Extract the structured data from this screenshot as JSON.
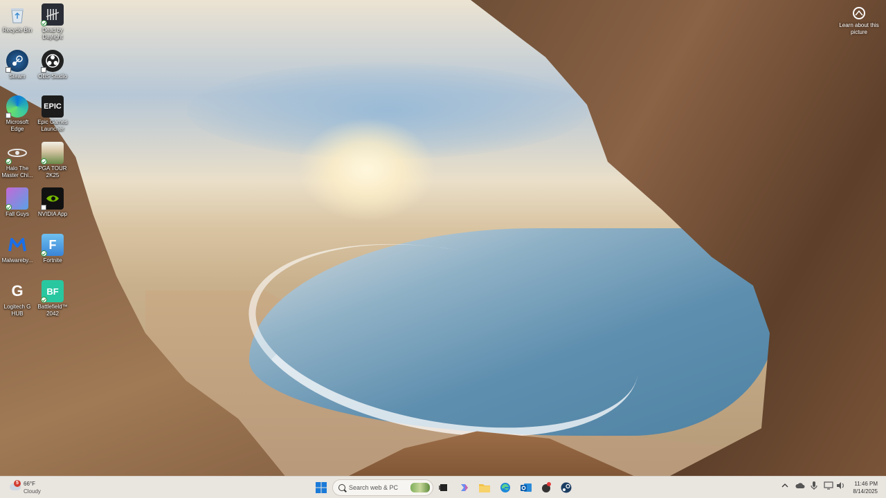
{
  "desktop": {
    "icons": [
      {
        "label": "Recycle Bin",
        "icon": "recycle-bin-icon"
      },
      {
        "label": "Dead by Daylight",
        "icon": "dead-by-daylight-icon"
      },
      {
        "label": "Steam",
        "icon": "steam-icon"
      },
      {
        "label": "OBS Studio",
        "icon": "obs-studio-icon"
      },
      {
        "label": "Microsoft Edge",
        "icon": "edge-icon"
      },
      {
        "label": "Epic Games Launcher",
        "icon": "epic-games-icon",
        "glyph": "EPIC"
      },
      {
        "label": "Halo The Master Chi...",
        "icon": "halo-icon"
      },
      {
        "label": "PGA TOUR 2K25",
        "icon": "pga-tour-icon"
      },
      {
        "label": "Fall Guys",
        "icon": "fall-guys-icon"
      },
      {
        "label": "NVIDIA App",
        "icon": "nvidia-icon"
      },
      {
        "label": "Malwareby...",
        "icon": "malwarebytes-icon"
      },
      {
        "label": "Fortnite",
        "icon": "fortnite-icon",
        "glyph": "F"
      },
      {
        "label": "Logitech G HUB",
        "icon": "logitech-g-hub-icon",
        "glyph": "G"
      },
      {
        "label": "Battlefield™ 2042",
        "icon": "battlefield-icon",
        "glyph": "BF"
      }
    ],
    "learn_about": "Learn about this picture"
  },
  "taskbar": {
    "weather": {
      "temp": "66°F",
      "condition": "Cloudy",
      "badge": "5"
    },
    "search_placeholder": "Search web & PC",
    "clock": {
      "time": "11:46 PM",
      "date": "8/14/2025"
    }
  },
  "colors": {
    "taskbar_bg": "#e8e4de",
    "accent": "#0078d4"
  }
}
